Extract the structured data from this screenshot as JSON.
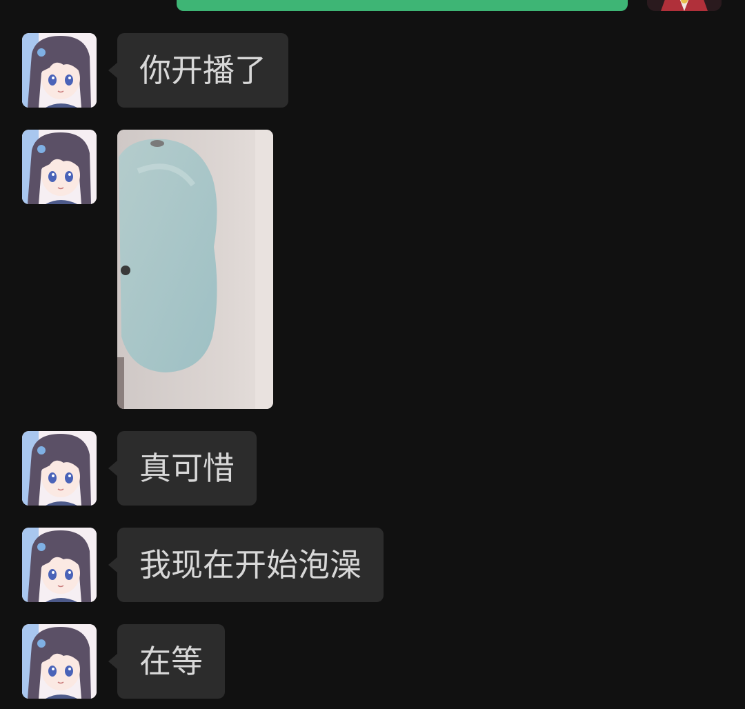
{
  "colors": {
    "background": "#111111",
    "incoming_bubble": "#2c2c2c",
    "outgoing_bubble": "#3eb575",
    "text": "#d8d8d8"
  },
  "previous_message": {
    "sender": "me",
    "type": "text-bubble-partial"
  },
  "messages": [
    {
      "sender": "contact",
      "type": "text",
      "text": "你开播了"
    },
    {
      "sender": "contact",
      "type": "image",
      "image_icon": "bathtub-photo"
    },
    {
      "sender": "contact",
      "type": "text",
      "text": "真可惜"
    },
    {
      "sender": "contact",
      "type": "text",
      "text": "我现在开始泡澡"
    },
    {
      "sender": "contact",
      "type": "text",
      "text": "在等"
    }
  ]
}
